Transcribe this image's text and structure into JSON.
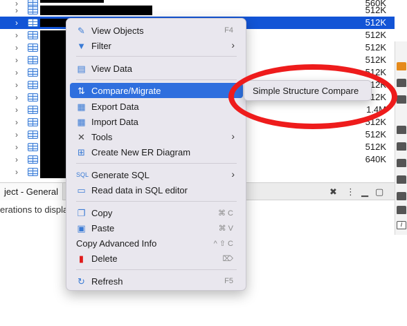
{
  "tree": {
    "rows": [
      {
        "size": "560K",
        "selected": false
      },
      {
        "size": "512K",
        "selected": false
      },
      {
        "size": "512K",
        "selected": true
      },
      {
        "size": "512K",
        "selected": false
      },
      {
        "size": "512K",
        "selected": false
      },
      {
        "size": "512K",
        "selected": false
      },
      {
        "size": "512K",
        "selected": false
      },
      {
        "size": "512K",
        "selected": false
      },
      {
        "size": "512K",
        "selected": false
      },
      {
        "size": "1.4M",
        "selected": false
      },
      {
        "size": "512K",
        "selected": false
      },
      {
        "size": "512K",
        "selected": false
      },
      {
        "size": "512K",
        "selected": false
      },
      {
        "size": "640K",
        "selected": false
      }
    ]
  },
  "bottom": {
    "tab_label": "ject - General",
    "message": "erations to display"
  },
  "menu": {
    "view_objects": {
      "label": "View  Objects",
      "shortcut": "F4"
    },
    "filter": {
      "label": "Filter"
    },
    "view_data": {
      "label": "View Data"
    },
    "compare_migrate": {
      "label": "Compare/Migrate"
    },
    "export_data": {
      "label": "Export Data"
    },
    "import_data": {
      "label": "Import Data"
    },
    "tools": {
      "label": "Tools"
    },
    "create_er": {
      "label": "Create New ER Diagram"
    },
    "generate_sql": {
      "label": "Generate SQL"
    },
    "read_sql": {
      "label": "Read data in SQL editor"
    },
    "copy": {
      "label": "Copy",
      "shortcut": "⌘ C"
    },
    "paste": {
      "label": "Paste",
      "shortcut": "⌘ V"
    },
    "copy_advanced": {
      "label": "Copy Advanced Info",
      "shortcut": "^ ⇧ C"
    },
    "delete": {
      "label": "Delete",
      "shortcut": "⌦"
    },
    "refresh": {
      "label": "Refresh",
      "shortcut": "F5"
    }
  },
  "submenu": {
    "simple_structure_compare": "Simple Structure Compare"
  },
  "colors": {
    "selection": "#1254d6",
    "highlight": "#2f6fde",
    "annotation": "#ee1c1c"
  }
}
